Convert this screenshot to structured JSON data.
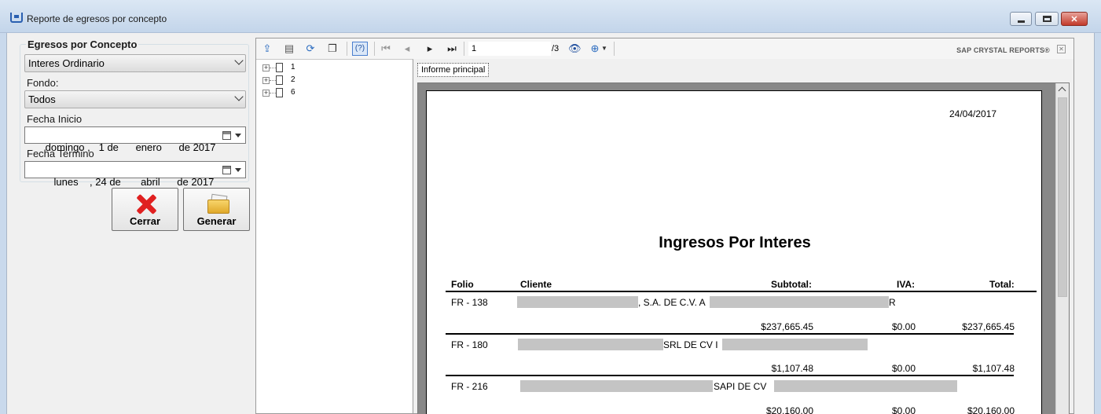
{
  "window": {
    "title": "Reporte de egresos por concepto"
  },
  "form": {
    "group_title": "Egresos por Concepto",
    "concepto_value": "Interes Ordinario",
    "fondo_label": "Fondo:",
    "fondo_value": "Todos",
    "fecha_inicio_label": "Fecha Inicio",
    "fecha_inicio_value": "domingo ,   1 de      enero      de 2017",
    "fecha_termino_label": "Fecha Termino",
    "fecha_termino_value": "   lunes    , 24 de       abril      de 2017",
    "cerrar_label": "Cerrar",
    "generar_label": "Generar"
  },
  "viewer": {
    "help_glyph": "(?)",
    "current_page": "1",
    "page_total": "/3",
    "brand": "SAP CRYSTAL REPORTS®",
    "tab_label": "Informe principal",
    "tree": [
      "1",
      "2",
      "6"
    ]
  },
  "report": {
    "date": "24/04/2017",
    "title": "Ingresos Por Interes",
    "headers": {
      "folio": "Folio",
      "cliente": "Cliente",
      "subtotal": "Subtotal:",
      "iva": "IVA:",
      "total": "Total:"
    },
    "rows": [
      {
        "folio": "FR - 138",
        "cliente_visible": ", S.A. DE C.V. A",
        "cliente_tail": "R",
        "subtotal": "$237,665.45",
        "iva": "$0.00",
        "total": "$237,665.45"
      },
      {
        "folio": "FR - 180",
        "cliente_visible": "SRL DE CV I",
        "subtotal": "$1,107.48",
        "iva": "$0.00",
        "total": "$1,107.48"
      },
      {
        "folio": "FR - 216",
        "cliente_visible": "SAPI DE CV",
        "subtotal": "$20,160.00",
        "iva": "$0.00",
        "total": "$20,160.00"
      }
    ]
  }
}
